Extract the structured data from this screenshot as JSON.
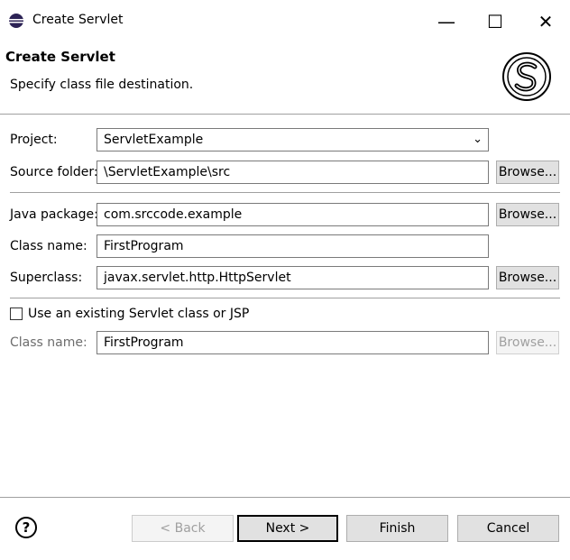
{
  "window": {
    "title": "Create Servlet",
    "minimize": "—",
    "maximize": "☐",
    "close": "✕"
  },
  "header": {
    "title": "Create Servlet",
    "subtitle": "Specify class file destination."
  },
  "form": {
    "project_label": "Project:",
    "project_value": "ServletExample",
    "source_folder_label": "Source folder:",
    "source_folder_value": "\\ServletExample\\src",
    "java_package_label": "Java package:",
    "java_package_value": "com.srccode.example",
    "class_name_label": "Class name:",
    "class_name_value": "FirstProgram",
    "superclass_label": "Superclass:",
    "superclass_value": "javax.servlet.http.HttpServlet",
    "browse_label": "Browse...",
    "use_existing_label": "Use an existing Servlet class or JSP",
    "existing_class_name_label": "Class name:",
    "existing_class_name_value": "FirstProgram"
  },
  "footer": {
    "help": "?",
    "back": "< Back",
    "next": "Next >",
    "finish": "Finish",
    "cancel": "Cancel"
  }
}
